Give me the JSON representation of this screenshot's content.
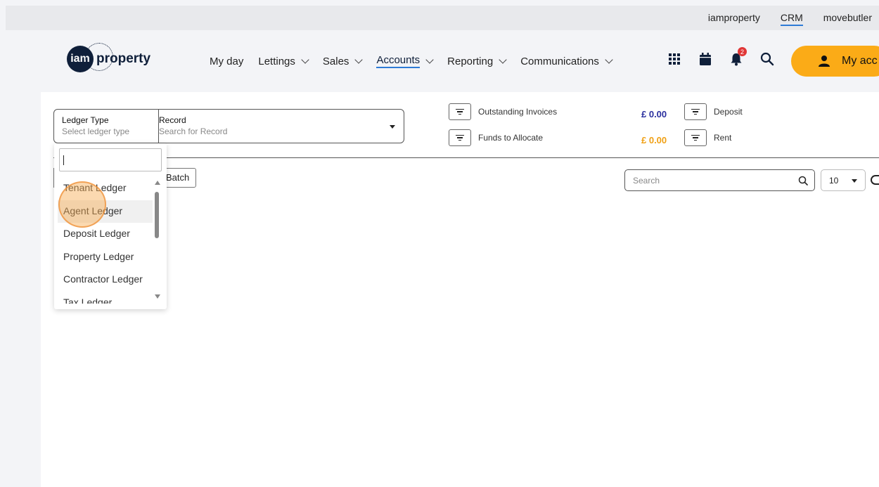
{
  "top_links": [
    "iamproperty",
    "CRM",
    "movebutler"
  ],
  "brand": {
    "logo_circle": "iam",
    "logo_text": "property"
  },
  "main_nav": [
    {
      "label": "My day",
      "has_menu": false
    },
    {
      "label": "Lettings",
      "has_menu": true
    },
    {
      "label": "Sales",
      "has_menu": true
    },
    {
      "label": "Accounts",
      "has_menu": true,
      "active": true
    },
    {
      "label": "Reporting",
      "has_menu": true
    },
    {
      "label": "Communications",
      "has_menu": true
    }
  ],
  "header_icons": [
    "grid-icon",
    "calendar-icon",
    "bell-icon",
    "search-icon"
  ],
  "notification_count": "2",
  "account_button": "My acc",
  "ledger_select": {
    "label": "Ledger Type",
    "placeholder": "Select ledger type"
  },
  "record_select": {
    "label": "Record",
    "placeholder": "Search for Record"
  },
  "summary": {
    "outstanding_invoices": {
      "label": "Outstanding Invoices",
      "amount": "£ 0.00"
    },
    "funds_to_allocate": {
      "label": "Funds to Allocate",
      "amount": "£ 0.00"
    },
    "deposit": {
      "label": "Deposit"
    },
    "rent": {
      "label": "Rent"
    }
  },
  "batch_button": "Batch",
  "table_search": {
    "placeholder": "Search"
  },
  "page_size": "10",
  "ledger_options": [
    "Tenant Ledger",
    "Agent Ledger",
    "Deposit Ledger",
    "Property Ledger",
    "Contractor Ledger",
    "Tax Ledger"
  ],
  "hovered_option": "Agent Ledger",
  "colors": {
    "accent": "#fbab17",
    "nav_active": "#2e7bd6",
    "amount_blue": "#2a2f9e",
    "amount_orange": "#f0a014",
    "badge": "#e03636"
  }
}
